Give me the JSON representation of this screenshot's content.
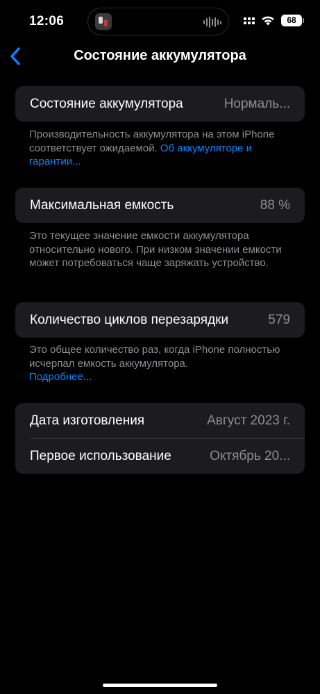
{
  "status_bar": {
    "time": "12:06",
    "battery_level": "68",
    "icons": [
      "signal-icon",
      "wifi-icon",
      "battery-icon"
    ]
  },
  "nav": {
    "title": "Состояние аккумулятора",
    "back_icon": "chevron-left-icon"
  },
  "health": {
    "label": "Состояние аккумулятора",
    "value": "Нормаль..."
  },
  "health_note": {
    "text": "Производительность аккумулятора на этом iPhone соответствует ожидаемой. ",
    "link": "Об аккумуляторе и гарантии..."
  },
  "capacity": {
    "label": "Максимальная емкость",
    "value": "88 %"
  },
  "capacity_note": {
    "text": "Это текущее значение емкости аккумулятора относительно нового. При низком значении емкости может потребоваться чаще заряжать устройство."
  },
  "cycles": {
    "label": "Количество циклов перезарядки",
    "value": "579"
  },
  "cycles_note": {
    "text": "Это общее количество раз, когда iPhone полностью исчерпал емкость аккумулятора.",
    "link": "Подробнее..."
  },
  "dates": {
    "manufacture_label": "Дата изготовления",
    "manufacture_value": "Август 2023 г.",
    "first_use_label": "Первое использование",
    "first_use_value": "Октябрь 20..."
  },
  "colors": {
    "background": "#000000",
    "card": "#1c1c1e",
    "accent": "#0a84ff",
    "secondary_text": "#8e8e93"
  }
}
